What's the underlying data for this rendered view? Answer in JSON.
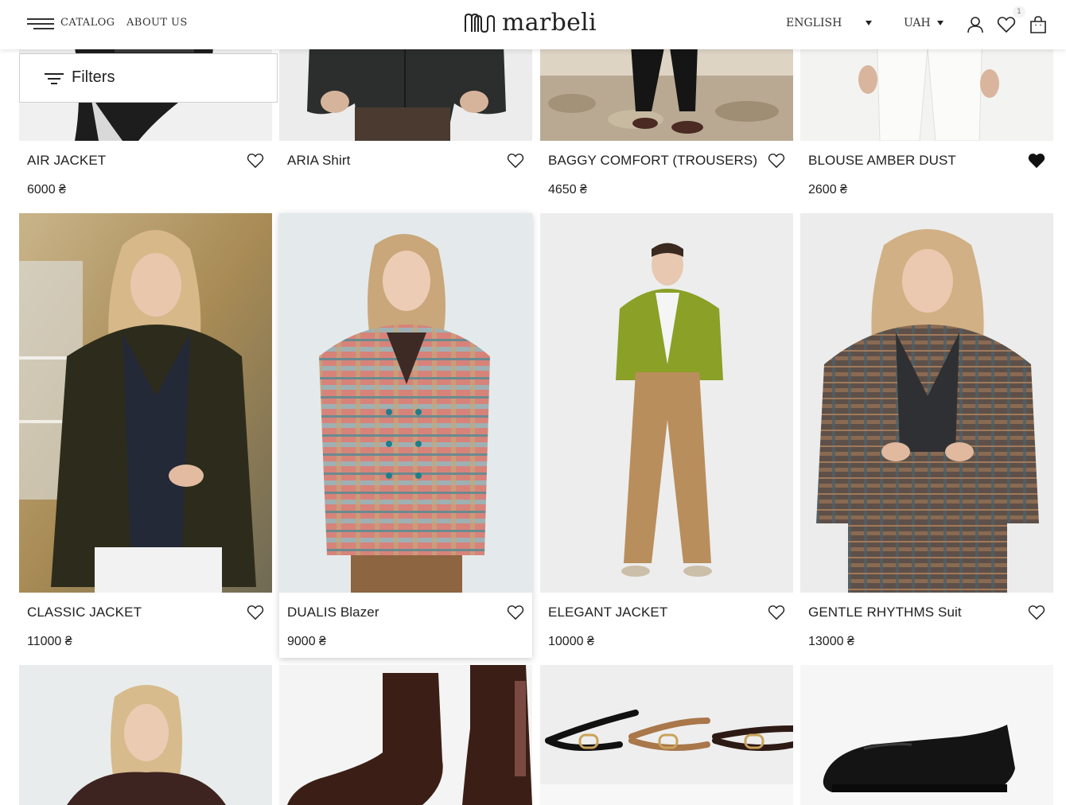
{
  "header": {
    "catalog_label": "CATALOG",
    "about_label": "ABOUT US",
    "logo_text": "marbeli",
    "language": "ENGLISH",
    "currency": "UAH",
    "wishlist_count": "1"
  },
  "filters": {
    "label": "Filters"
  },
  "products": [
    {
      "name": "AIR JACKET",
      "price": "6000 ₴",
      "favorited": false
    },
    {
      "name": "ARIA Shirt",
      "price": "",
      "favorited": false
    },
    {
      "name": "BAGGY COMFORT (TROUSERS)",
      "price": "4650 ₴",
      "favorited": false
    },
    {
      "name": "BLOUSE AMBER DUST",
      "price": "2600 ₴",
      "favorited": true
    },
    {
      "name": "CLASSIC JACKET",
      "price": "11000 ₴",
      "favorited": false
    },
    {
      "name": "DUALIS Blazer",
      "price": "9000 ₴",
      "favorited": false
    },
    {
      "name": "ELEGANT JACKET",
      "price": "10000 ₴",
      "favorited": false
    },
    {
      "name": "GENTLE RHYTHMS Suit",
      "price": "13000 ₴",
      "favorited": false
    }
  ],
  "colors": {
    "text": "#222222",
    "border": "#cfcfcf"
  }
}
